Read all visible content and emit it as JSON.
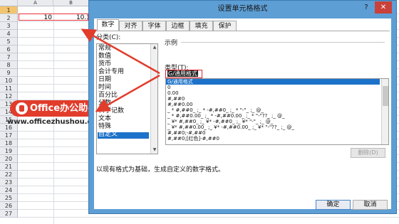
{
  "sheet": {
    "columns": [
      "A",
      "B"
    ],
    "rows": [
      "1",
      "2",
      "3",
      "4",
      "5",
      "6",
      "7",
      "8",
      "9",
      "10",
      "11",
      "12",
      "13",
      "14",
      "15",
      "16",
      "17",
      "18",
      "19",
      "20",
      "21",
      "22",
      "23",
      "24",
      "25",
      "26",
      "27"
    ],
    "cells": {
      "a1": "10",
      "b1": "10.1"
    }
  },
  "watermark": {
    "title": "Office办公助手",
    "url": "www.officezhushou.com"
  },
  "dialog": {
    "title": "设置单元格格式",
    "help": "?",
    "close": "✕",
    "tabs": [
      "数字",
      "对齐",
      "字体",
      "边框",
      "填充",
      "保护"
    ],
    "category_label": "分类(C):",
    "categories": [
      "常规",
      "数值",
      "货币",
      "会计专用",
      "日期",
      "时间",
      "百分比",
      "分数",
      "科学记数",
      "文本",
      "特殊",
      "自定义"
    ],
    "sample_label": "示例",
    "type_label": "类型(T):",
    "type_value": "G/通用格式",
    "formats": [
      "G/通用格式",
      "0",
      "0.00",
      "#,##0",
      "#,##0.00",
      "_ * #,##0_ ;_ * -#,##0_ ;_ * \"-\"_ ;_ @_",
      "_ * #,##0.00_ ;_ * -#,##0.00_ ;_ * \"-\"??_ ;_ @_",
      "_ ¥* #,##0_ ;_ ¥* -#,##0_ ;_ ¥* \"-\"_ ;_ @_",
      "_ ¥* #,##0.00_ ;_ ¥* -#,##0.00_ ;_ ¥* \"-\"??_ ;_ @_",
      "#,##0;-#,##0",
      "#,##0;[红色]-#,##0"
    ],
    "delete_label": "删除(D)",
    "description": "以现有格式为基础，生成自定义的数字格式。",
    "ok_label": "确定",
    "cancel_label": "取消"
  },
  "colors": {
    "accent": "#e23c2b",
    "dialog_frame": "#5d9ed4",
    "selection": "#1c72c9"
  }
}
